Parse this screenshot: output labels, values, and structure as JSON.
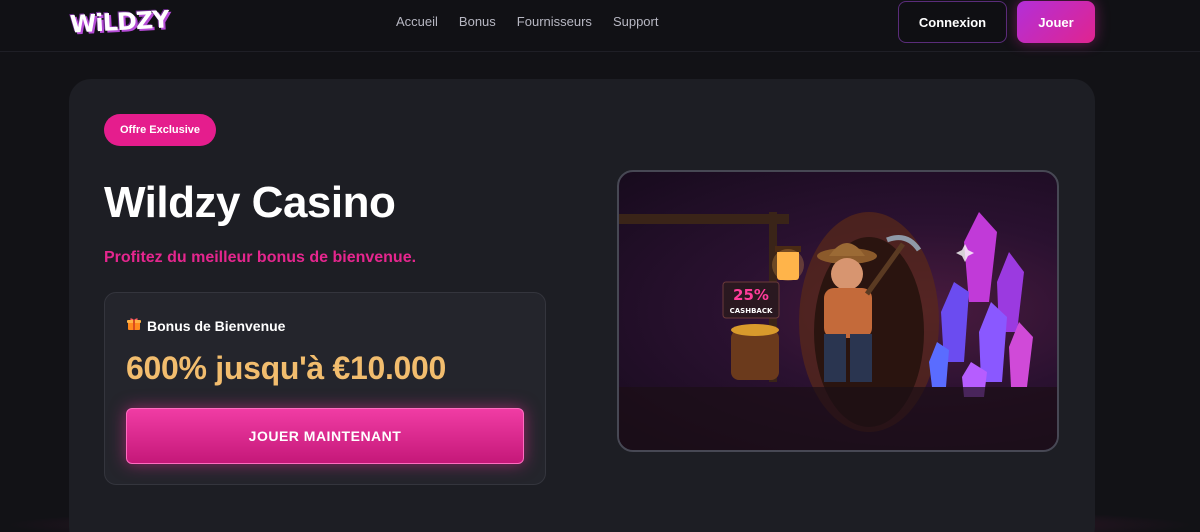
{
  "header": {
    "logo": "WiLDZY",
    "nav": [
      "Accueil",
      "Bonus",
      "Fournisseurs",
      "Support"
    ],
    "login_label": "Connexion",
    "play_label": "Jouer"
  },
  "hero": {
    "badge": "Offre Exclusive",
    "title": "Wildzy Casino",
    "subtitle": "Profitez du meilleur bonus de bienvenue.",
    "bonus_label": "Bonus de Bienvenue",
    "bonus_amount": "600% jusqu'à €10.000",
    "cta_label": "JOUER MAINTENANT",
    "gift_icon": "gift-icon"
  },
  "artwork": {
    "sign_percent": "25%",
    "sign_text": "CASHBACK"
  },
  "colors": {
    "accent_pink": "#e51d8d",
    "bonus_gold": "#f2bd6e",
    "background": "#121216",
    "card": "#1d1e24"
  }
}
